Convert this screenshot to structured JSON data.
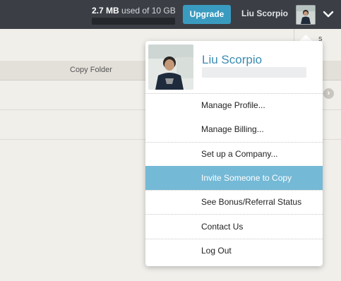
{
  "header": {
    "storage_used": "2.7 MB",
    "storage_rest": "used of 10 GB",
    "storage_fraction": 0.0003,
    "upgrade_label": "Upgrade",
    "user_name": "Liu Scorpio"
  },
  "table": {
    "column_label": "Copy Folder",
    "right_column_fragment": "s"
  },
  "menu": {
    "profile_name": "Liu Scorpio",
    "items": [
      {
        "label": "Manage Profile..."
      },
      {
        "label": "Manage Billing..."
      },
      {
        "label": "Set up a Company..."
      },
      {
        "label": "Invite Someone to Copy"
      },
      {
        "label": "See Bonus/Referral Status"
      },
      {
        "label": "Contact Us"
      },
      {
        "label": "Log Out"
      }
    ]
  },
  "colors": {
    "topbar": "#3b3f45",
    "accent": "#3a9bc0",
    "highlight": "#74b9d6",
    "name_blue": "#3a8bb2"
  }
}
